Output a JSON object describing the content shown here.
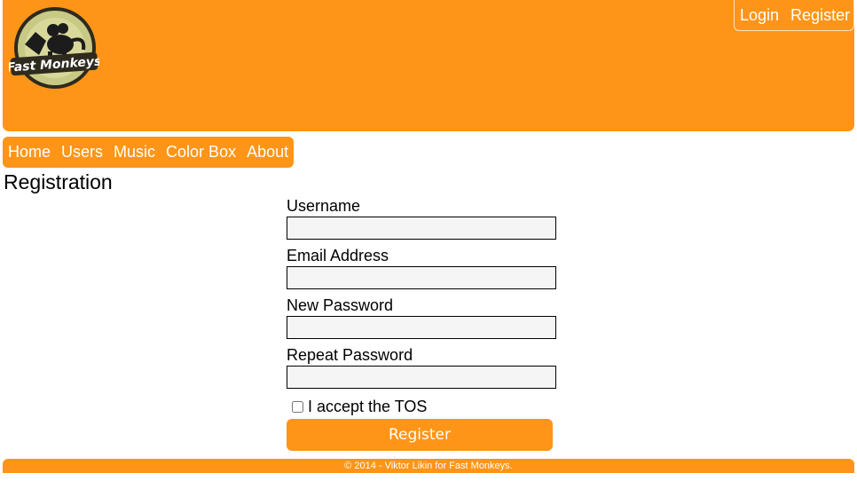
{
  "header": {
    "logo": {
      "text": "Fast Monkeys",
      "icon": "monkey-logo-icon"
    },
    "auth_links": {
      "login": "Login",
      "register": "Register"
    }
  },
  "nav": {
    "items": [
      "Home",
      "Users",
      "Music",
      "Color Box",
      "About"
    ]
  },
  "page": {
    "title": "Registration"
  },
  "form": {
    "fields": {
      "username": {
        "label": "Username",
        "value": ""
      },
      "email": {
        "label": "Email Address",
        "value": ""
      },
      "new_password": {
        "label": "New Password",
        "value": ""
      },
      "repeat_password": {
        "label": "Repeat Password",
        "value": ""
      }
    },
    "tos_label": "I accept the TOS",
    "tos_checked": false,
    "submit_label": "Register"
  },
  "footer": {
    "text": "© 2014 - Viktor Likin for Fast Monkeys."
  },
  "colors": {
    "accent": "#fe9518",
    "input_bg": "#f5f5f5"
  }
}
